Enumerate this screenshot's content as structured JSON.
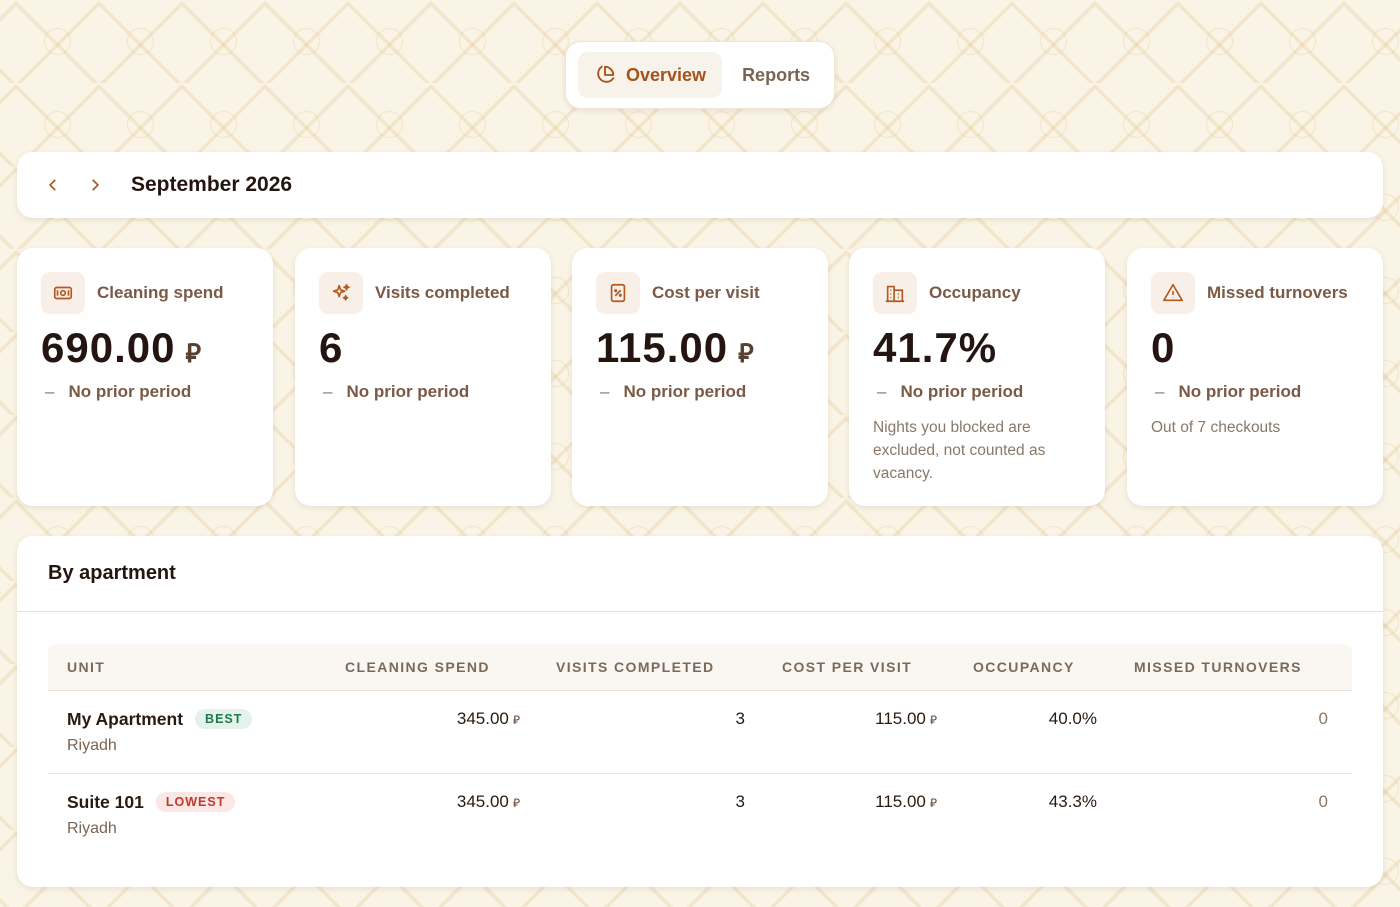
{
  "tabs": {
    "overview_label": "Overview",
    "reports_label": "Reports",
    "active": "Overview"
  },
  "period": {
    "label": "September 2026"
  },
  "currency_symbol": "⃁",
  "kpis": [
    {
      "label": "Cleaning spend",
      "value": "690.00",
      "has_currency": true,
      "delta": "No prior period",
      "note": "",
      "icon": "money-icon"
    },
    {
      "label": "Visits completed",
      "value": "6",
      "has_currency": false,
      "delta": "No prior period",
      "note": "",
      "icon": "sparkles-icon"
    },
    {
      "label": "Cost per visit",
      "value": "115.00",
      "has_currency": true,
      "delta": "No prior period",
      "note": "",
      "icon": "receipt-percent-icon"
    },
    {
      "label": "Occupancy",
      "value": "41.7%",
      "has_currency": false,
      "delta": "No prior period",
      "note": "Nights you blocked are excluded, not counted as vacancy.",
      "icon": "building-icon"
    },
    {
      "label": "Missed turnovers",
      "value": "0",
      "has_currency": false,
      "delta": "No prior period",
      "note": "Out of 7 checkouts",
      "icon": "warning-icon"
    }
  ],
  "delta_dash": "–",
  "by_apartment": {
    "title": "By apartment",
    "columns": [
      "UNIT",
      "CLEANING SPEND",
      "VISITS COMPLETED",
      "COST PER VISIT",
      "OCCUPANCY",
      "MISSED TURNOVERS"
    ],
    "rows": [
      {
        "unit": "My Apartment",
        "badge": "BEST",
        "badge_type": "best",
        "city": "Riyadh",
        "cleaning_spend": "345.00",
        "visits": "3",
        "cost_per_visit": "115.00",
        "occupancy": "40.0%",
        "missed": "0"
      },
      {
        "unit": "Suite 101",
        "badge": "LOWEST",
        "badge_type": "lowest",
        "city": "Riyadh",
        "cleaning_spend": "345.00",
        "visits": "3",
        "cost_per_visit": "115.00",
        "occupancy": "43.3%",
        "missed": "0"
      }
    ]
  },
  "colors": {
    "accent": "#a5521b",
    "background": "#faf4e6",
    "best_badge": "#1f7a4e",
    "lowest_badge": "#c0392b"
  }
}
